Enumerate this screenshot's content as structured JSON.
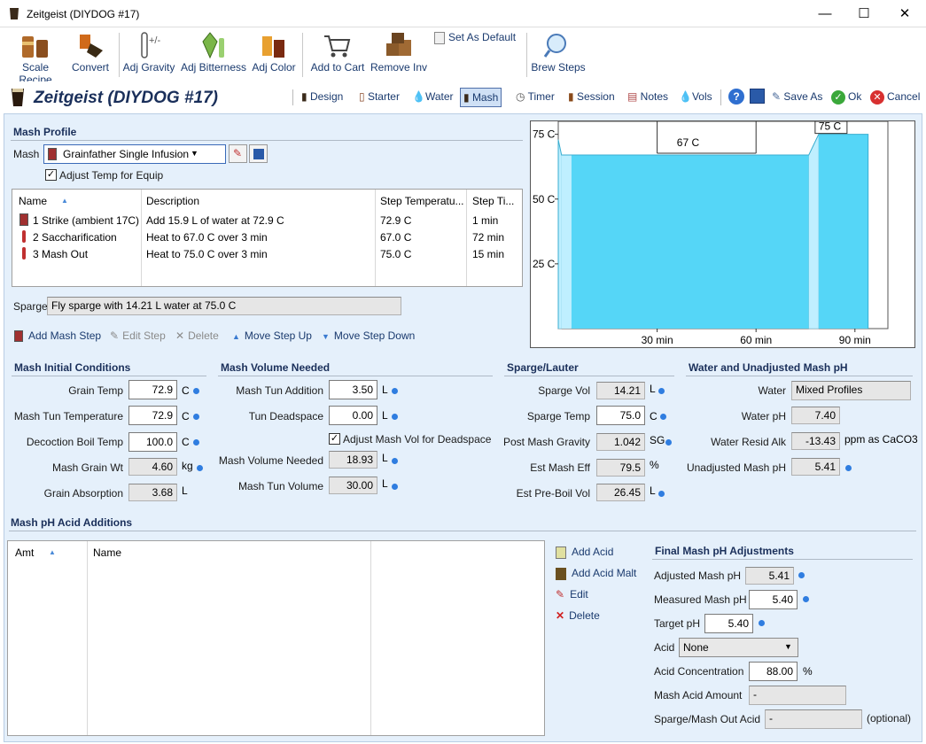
{
  "window": {
    "title": "Zeitgeist (DIYDOG #17)",
    "minimize": "—",
    "maximize": "☐",
    "close": "✕"
  },
  "toolbar": {
    "scale_recipe": "Scale Recipe",
    "convert": "Convert",
    "adj_gravity": "Adj Gravity",
    "adj_bitterness": "Adj Bitterness",
    "adj_color": "Adj Color",
    "add_to_cart": "Add to Cart",
    "remove_inv": "Remove Inv",
    "set_as_default": "Set As Default",
    "brew_steps": "Brew Steps"
  },
  "header": {
    "recipe_title": "Zeitgeist (DIYDOG #17)",
    "tabs": [
      "Design",
      "Starter",
      "Water",
      "Mash",
      "Timer",
      "Session",
      "Notes",
      "Vols"
    ],
    "selected_tab": "Mash",
    "save_as": "Save As",
    "ok": "Ok",
    "cancel": "Cancel"
  },
  "mash_profile": {
    "section": "Mash Profile",
    "mash_label": "Mash",
    "mash_value": "Grainfather Single Infusion",
    "adjust_temp_label": "Adjust Temp for Equip",
    "columns": [
      "Name",
      "Description",
      "Step Temperatu...",
      "Step Ti..."
    ],
    "steps": [
      {
        "name": "1 Strike (ambient 17C)",
        "description": "Add 15.9 L of water at 72.9 C",
        "temp": "72.9 C",
        "time": "1 min"
      },
      {
        "name": "2 Saccharification",
        "description": "Heat to 67.0 C over 3 min",
        "temp": "67.0 C",
        "time": "72 min"
      },
      {
        "name": "3 Mash Out",
        "description": "Heat to 75.0 C over 3 min",
        "temp": "75.0 C",
        "time": "15 min"
      }
    ],
    "sparge_label": "Sparge",
    "sparge_value": "Fly sparge with 14.21 L water at 75.0 C",
    "actions": {
      "add": "Add Mash Step",
      "edit": "Edit Step",
      "delete": "Delete",
      "up": "Move Step Up",
      "down": "Move Step Down"
    }
  },
  "chart_data": {
    "type": "area",
    "x": [
      0,
      1,
      4,
      76,
      79,
      94
    ],
    "y": [
      72.9,
      67.0,
      67.0,
      67.0,
      75.0,
      75.0
    ],
    "step_labels": [
      "67 C",
      "75 C"
    ],
    "xticks": [
      "30 min",
      "60 min",
      "90 min"
    ],
    "xtick_values": [
      30,
      60,
      90
    ],
    "yticks": [
      "25 C",
      "50 C",
      "75 C"
    ],
    "ytick_values": [
      25,
      50,
      75
    ],
    "xlim": [
      0,
      100
    ],
    "ylim": [
      0,
      80
    ],
    "fill_color": "#55d6f7",
    "light_color": "#bfefff"
  },
  "initial": {
    "section": "Mash Initial Conditions",
    "grain_temp_label": "Grain Temp",
    "grain_temp": "72.9",
    "grain_temp_unit": "C",
    "tun_temp_label": "Mash Tun Temperature",
    "tun_temp": "72.9",
    "tun_temp_unit": "C",
    "decoction_label": "Decoction Boil Temp",
    "decoction": "100.0",
    "decoction_unit": "C",
    "grain_wt_label": "Mash Grain Wt",
    "grain_wt": "4.60",
    "grain_wt_unit": "kg",
    "absorption_label": "Grain Absorption",
    "absorption": "3.68",
    "absorption_unit": "L"
  },
  "volume": {
    "section": "Mash Volume Needed",
    "tun_addition_label": "Mash Tun Addition",
    "tun_addition": "3.50",
    "tun_addition_unit": "L",
    "deadspace_label": "Tun Deadspace",
    "deadspace": "0.00",
    "deadspace_unit": "L",
    "adjust_label": "Adjust Mash Vol for Deadspace",
    "needed_label": "Mash Volume Needed",
    "needed": "18.93",
    "needed_unit": "L",
    "tun_vol_label": "Mash Tun Volume",
    "tun_vol": "30.00",
    "tun_vol_unit": "L"
  },
  "sparge": {
    "section": "Sparge/Lauter",
    "vol_label": "Sparge Vol",
    "vol": "14.21",
    "vol_unit": "L",
    "temp_label": "Sparge Temp",
    "temp": "75.0",
    "temp_unit": "C",
    "gravity_label": "Post Mash Gravity",
    "gravity": "1.042",
    "gravity_unit": "SG",
    "eff_label": "Est Mash Eff",
    "eff": "79.5",
    "eff_unit": "%",
    "preboil_label": "Est Pre-Boil Vol",
    "preboil": "26.45",
    "preboil_unit": "L"
  },
  "water": {
    "section": "Water and Unadjusted Mash pH",
    "water_label": "Water",
    "water": "Mixed Profiles",
    "ph_label": "Water pH",
    "ph": "7.40",
    "alk_label": "Water Resid Alk",
    "alk": "-13.43",
    "alk_unit": "ppm as CaCO3",
    "unadj_label": "Unadjusted Mash pH",
    "unadj": "5.41"
  },
  "acid": {
    "section": "Mash pH Acid Additions",
    "columns": [
      "Amt",
      "Name"
    ],
    "add_acid": "Add Acid",
    "add_acid_malt": "Add Acid Malt",
    "edit": "Edit",
    "delete": "Delete"
  },
  "final": {
    "section": "Final Mash pH Adjustments",
    "adjusted_label": "Adjusted Mash pH",
    "adjusted": "5.41",
    "measured_label": "Measured Mash pH",
    "measured": "5.40",
    "target_label": "Target pH",
    "target": "5.40",
    "acid_label": "Acid",
    "acid": "None",
    "conc_label": "Acid Concentration",
    "conc": "88.00",
    "conc_unit": "%",
    "amount_label": "Mash Acid Amount",
    "amount": "-",
    "sparge_acid_label": "Sparge/Mash Out Acid",
    "sparge_acid": "-",
    "optional": "(optional)"
  }
}
